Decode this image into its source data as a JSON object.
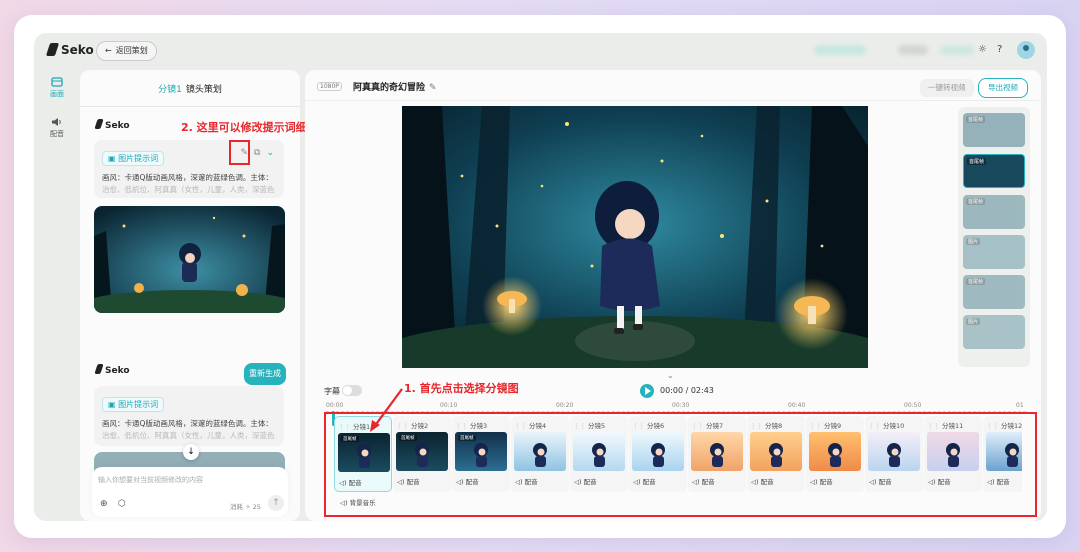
{
  "brand": {
    "name": "Seko",
    "accent": "#27b3be",
    "annotation_color": "#e8262b"
  },
  "topbar": {
    "back_label": "返回策划",
    "icons": [
      "sun-icon",
      "help-icon",
      "avatar-icon"
    ]
  },
  "rail": [
    {
      "label": "画面",
      "icon": "image-icon",
      "active": true
    },
    {
      "label": "配音",
      "icon": "speaker-icon",
      "active": false
    }
  ],
  "script_panel": {
    "shot_label": "分镜1",
    "title": "镜头策划",
    "messages": [
      {
        "author": "Seko",
        "tag": "图片提示词",
        "text": "画风：卡通Q版动画风格，深邃的蓝绿色调。主体：",
        "faded": "治愈、低机位、阿真真（女性，儿童，人类，深蓝色"
      },
      {
        "author": "Seko",
        "tag": "图片提示词",
        "text": "画风：卡通Q版动画风格，深邃的蓝绿色调。主体：",
        "faded": "治愈、低机位、阿真真（女性，儿童，人类，深蓝色"
      }
    ],
    "regen_label": "重新生成",
    "input_placeholder": "输入你想要对当前视频修改的内容",
    "cost": "消耗 ✧ 25"
  },
  "annotations": {
    "step1": "1. 首先点击选择分镜图",
    "step2": "2. 这里可以修改提示词细节"
  },
  "editor": {
    "resolution": "1080P",
    "title": "阿真真的奇幻冒险",
    "btn_convert": "一键转视频",
    "btn_export": "导出视频",
    "subtitle_label": "字幕",
    "time": "00:00 / 02:43",
    "ruler": [
      "00:00",
      "00:10",
      "00:20",
      "00:30",
      "00:40",
      "00:50",
      "01"
    ],
    "shots": [
      "分镜1",
      "分镜2",
      "分镜3",
      "分镜4",
      "分镜5",
      "分镜6",
      "分镜7",
      "分镜8",
      "分镜9",
      "分镜10",
      "分镜11",
      "分镜12"
    ],
    "shot_tag": "首尾帧",
    "audio_label": "配音",
    "music_label": "背景音乐",
    "strip_tags": [
      "首尾帧",
      "首尾帧",
      "首尾帧",
      "图片",
      "首尾帧",
      "图片"
    ]
  }
}
